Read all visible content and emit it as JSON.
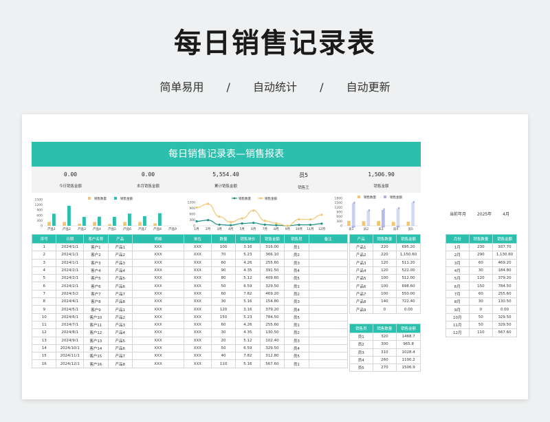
{
  "promo": {
    "title": "每日销售记录表",
    "subtitle": [
      "简单易用",
      "/",
      "自动统计",
      "/",
      "自动更新"
    ]
  },
  "sheet": {
    "banner": "每日销售记录表—销售报表",
    "stats": [
      {
        "value": "0.00",
        "label": "今日销售金额"
      },
      {
        "value": "0.00",
        "label": "本月销售金额"
      },
      {
        "value": "5,554.40",
        "label": "累计销售金额"
      },
      {
        "value": "员5",
        "label": "销售王"
      },
      {
        "value": "1,506.90",
        "label": "销售金额"
      }
    ],
    "period": {
      "label": "当前年月",
      "year": "2025年",
      "month": "4月"
    }
  },
  "colors": {
    "teal": "#2cbfae",
    "gold": "#f2c66f",
    "dark_teal": "#1f8f83",
    "lavender": "#a9b3e8"
  },
  "chart_data": [
    {
      "type": "bar",
      "categories": [
        "产品1",
        "产品2",
        "产品3",
        "产品4",
        "产品5",
        "产品6",
        "产品7",
        "产品8",
        "产品9"
      ],
      "series": [
        {
          "name": "销售数量",
          "values": [
            220,
            220,
            120,
            220,
            100,
            220,
            220,
            140,
            0
          ]
        },
        {
          "name": "销售金额",
          "values": [
            695.2,
            1150.6,
            511.2,
            522.0,
            512.0,
            698.6,
            550.0,
            722.4,
            0
          ]
        }
      ],
      "ylim": [
        0,
        1500
      ],
      "yticks": [
        "0",
        "300",
        "600",
        "900",
        "1200",
        "1500"
      ],
      "legend": "top"
    },
    {
      "type": "line",
      "categories": [
        "1月",
        "2月",
        "3月",
        "4月",
        "5月",
        "6月",
        "7月",
        "8月",
        "9月",
        "10月",
        "11月",
        "12月"
      ],
      "series": [
        {
          "name": "销售数量",
          "values": [
            230,
            290,
            60,
            30,
            120,
            150,
            60,
            30,
            0,
            50,
            50,
            110
          ]
        },
        {
          "name": "销售金额",
          "values": [
            937.7,
            1130.6,
            469.2,
            184.8,
            379.2,
            784.5,
            255.6,
            130.5,
            0,
            329.5,
            329.5,
            567.6
          ]
        }
      ],
      "ylim": [
        0,
        1200
      ],
      "yticks": [
        "0",
        "300",
        "600",
        "900",
        "1200"
      ],
      "legend": "top"
    },
    {
      "type": "bar",
      "categories": [
        "员1",
        "员2",
        "员3",
        "员4",
        "员5"
      ],
      "series": [
        {
          "name": "销售数量",
          "values": [
            320,
            300,
            310,
            260,
            270
          ]
        },
        {
          "name": "销售金额",
          "values": [
            1468.7,
            965.8,
            1028.4,
            1100.2,
            1506.9
          ]
        }
      ],
      "ylim": [
        0,
        1800
      ],
      "yticks": [
        "0",
        "300",
        "600",
        "900",
        "1200",
        "1500",
        "1800"
      ],
      "legend": "top"
    }
  ],
  "main_table": {
    "headers": [
      "序号",
      "日期",
      "客户名称",
      "产品",
      "明细",
      "单位",
      "数量",
      "销售单价",
      "销售金额",
      "销售员",
      "备注"
    ],
    "rows": [
      [
        "1",
        "2024/1/1",
        "客户1",
        "产品1",
        "XXX",
        "XXX",
        "100",
        "3.16",
        "316.00",
        "员1",
        ""
      ],
      [
        "2",
        "2024/1/1",
        "客户2",
        "产品2",
        "XXX",
        "XXX",
        "70",
        "5.23",
        "366.10",
        "员2",
        ""
      ],
      [
        "3",
        "2024/1/1",
        "客户3",
        "产品3",
        "XXX",
        "XXX",
        "60",
        "4.26",
        "255.60",
        "员3",
        ""
      ],
      [
        "4",
        "2024/2/1",
        "客户4",
        "产品4",
        "XXX",
        "XXX",
        "90",
        "4.35",
        "391.50",
        "员4",
        ""
      ],
      [
        "5",
        "2024/2/1",
        "客户5",
        "产品5",
        "XXX",
        "XXX",
        "80",
        "5.12",
        "409.60",
        "员5",
        ""
      ],
      [
        "6",
        "2024/2/1",
        "客户6",
        "产品6",
        "XXX",
        "XXX",
        "50",
        "6.59",
        "329.50",
        "员1",
        ""
      ],
      [
        "7",
        "2024/3/2",
        "客户7",
        "产品7",
        "XXX",
        "XXX",
        "60",
        "7.82",
        "469.20",
        "员2",
        ""
      ],
      [
        "8",
        "2024/4/1",
        "客户8",
        "产品8",
        "XXX",
        "XXX",
        "30",
        "5.16",
        "154.80",
        "员3",
        ""
      ],
      [
        "9",
        "2024/5/1",
        "客户9",
        "产品1",
        "XXX",
        "XXX",
        "120",
        "3.16",
        "379.20",
        "员4",
        ""
      ],
      [
        "10",
        "2024/6/1",
        "客户10",
        "产品2",
        "XXX",
        "XXX",
        "150",
        "5.23",
        "784.50",
        "员5",
        ""
      ],
      [
        "11",
        "2024/7/1",
        "客户11",
        "产品3",
        "XXX",
        "XXX",
        "60",
        "4.26",
        "255.60",
        "员1",
        ""
      ],
      [
        "12",
        "2024/8/1",
        "客户12",
        "产品4",
        "XXX",
        "XXX",
        "30",
        "4.35",
        "130.50",
        "员2",
        ""
      ],
      [
        "13",
        "2024/9/1",
        "客户13",
        "产品5",
        "XXX",
        "XXX",
        "20",
        "5.12",
        "102.40",
        "员3",
        ""
      ],
      [
        "14",
        "2024/10/1",
        "客户14",
        "产品6",
        "XXX",
        "XXX",
        "50",
        "6.59",
        "329.50",
        "员4",
        ""
      ],
      [
        "15",
        "2024/11/1",
        "客户15",
        "产品7",
        "XXX",
        "XXX",
        "40",
        "7.82",
        "312.80",
        "员5",
        ""
      ],
      [
        "16",
        "2024/12/1",
        "客户16",
        "产品8",
        "XXX",
        "XXX",
        "110",
        "5.16",
        "567.60",
        "员1",
        ""
      ]
    ]
  },
  "product_table": {
    "headers": [
      "产品",
      "销售数量",
      "销售金额"
    ],
    "rows": [
      [
        "产品1",
        "220",
        "695.20"
      ],
      [
        "产品2",
        "220",
        "1,150.60"
      ],
      [
        "产品3",
        "120",
        "511.20"
      ],
      [
        "产品4",
        "120",
        "522.00"
      ],
      [
        "产品5",
        "100",
        "512.00"
      ],
      [
        "产品6",
        "100",
        "698.60"
      ],
      [
        "产品7",
        "100",
        "550.00"
      ],
      [
        "产品8",
        "140",
        "722.40"
      ],
      [
        "产品9",
        "0",
        "0.00"
      ]
    ]
  },
  "sales_table": {
    "headers": [
      "销售员",
      "销售数量",
      "销售金额"
    ],
    "rows": [
      [
        "员1",
        "320",
        "1468.7"
      ],
      [
        "员2",
        "300",
        "965.8"
      ],
      [
        "员3",
        "310",
        "1028.4"
      ],
      [
        "员4",
        "260",
        "1100.2"
      ],
      [
        "员5",
        "270",
        "1506.9"
      ]
    ]
  },
  "month_table": {
    "headers": [
      "月份",
      "销售数量",
      "销售金额"
    ],
    "rows": [
      [
        "1月",
        "230",
        "937.70"
      ],
      [
        "2月",
        "290",
        "1,130.60"
      ],
      [
        "3月",
        "60",
        "469.20"
      ],
      [
        "4月",
        "30",
        "184.80"
      ],
      [
        "5月",
        "120",
        "379.20"
      ],
      [
        "6月",
        "150",
        "784.50"
      ],
      [
        "7月",
        "60",
        "255.60"
      ],
      [
        "8月",
        "30",
        "130.50"
      ],
      [
        "9月",
        "0",
        "0.00"
      ],
      [
        "10月",
        "50",
        "329.50"
      ],
      [
        "11月",
        "50",
        "329.50"
      ],
      [
        "12月",
        "110",
        "567.60"
      ]
    ]
  }
}
